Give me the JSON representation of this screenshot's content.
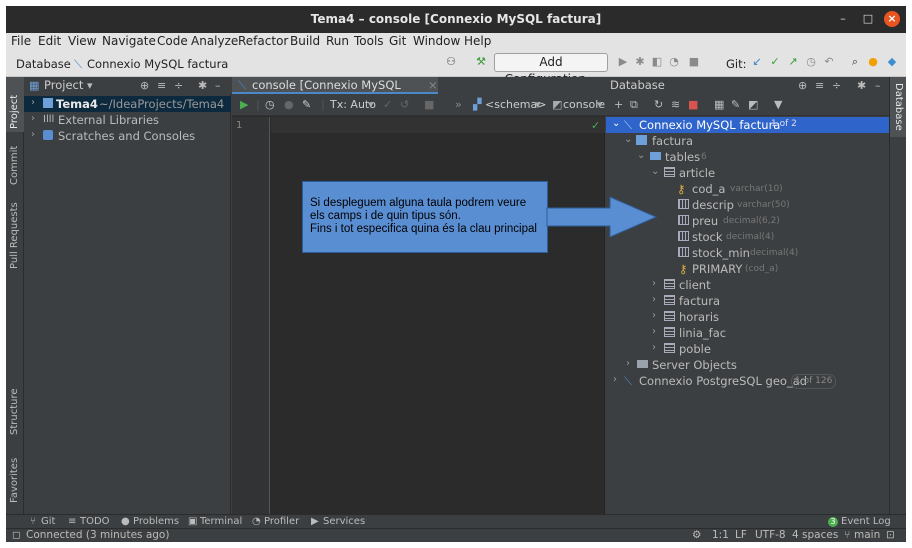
{
  "window": {
    "title": "Tema4 – console [Connexio MySQL factura]"
  },
  "menu": [
    "File",
    "Edit",
    "View",
    "Navigate",
    "Code",
    "Analyze",
    "Refactor",
    "Build",
    "Run",
    "Tools",
    "Git",
    "Window",
    "Help"
  ],
  "navbar": {
    "breadcrumb": [
      "Database",
      "Connexio MySQL factura"
    ],
    "config_button": "Add Configuration...",
    "git_label": "Git:"
  },
  "left_strip": [
    "Project",
    "Commit",
    "Pull Requests",
    "Structure",
    "Favorites"
  ],
  "right_strip": [
    "Database"
  ],
  "project": {
    "header": "Project",
    "items": [
      {
        "label": "Tema4",
        "path": "~/IdeaProjects/Tema4"
      },
      {
        "label": "External Libraries"
      },
      {
        "label": "Scratches and Consoles"
      }
    ]
  },
  "editor": {
    "tab": "console [Connexio MySQL factura]",
    "tx": "Tx: Auto",
    "schema": "<schema>",
    "console": "console",
    "line_number": "1"
  },
  "database": {
    "header": "Database",
    "connection": {
      "label": "Connexio MySQL factura",
      "badge": "1 of 2"
    },
    "schema": "factura",
    "tables_label": "tables",
    "tables_count": "6",
    "article": {
      "label": "article",
      "columns": [
        {
          "name": "cod_a",
          "type": "varchar(10)"
        },
        {
          "name": "descrip",
          "type": "varchar(50)"
        },
        {
          "name": "preu",
          "type": "decimal(6,2)"
        },
        {
          "name": "stock",
          "type": "decimal(4)"
        },
        {
          "name": "stock_min",
          "type": "decimal(4)"
        }
      ],
      "key": {
        "name": "PRIMARY",
        "cols": "(cod_a)"
      }
    },
    "other_tables": [
      "client",
      "factura",
      "horaris",
      "linia_fac",
      "poble"
    ],
    "server_objects": "Server Objects",
    "connection2": {
      "label": "Connexio PostgreSQL geo_ad",
      "badge": "1 of 126"
    }
  },
  "callout": {
    "lines": [
      "Si despleguem alguna taula podrem veure",
      "els camps i de quin tipus són.",
      "Fins i tot especifica quina és la clau principal"
    ]
  },
  "bottom_tabs": [
    "Git",
    "TODO",
    "Problems",
    "Terminal",
    "Profiler",
    "Services"
  ],
  "event_log": {
    "count": "3",
    "label": "Event Log"
  },
  "status": {
    "left": "Connected (3 minutes ago)",
    "position": "1:1",
    "line_sep": "LF",
    "encoding": "UTF-8",
    "indent": "4 spaces",
    "branch": "main"
  },
  "colors": {
    "selection": "#2f65ca",
    "accent": "#4a88c7",
    "callout": "#5a8ed2"
  }
}
